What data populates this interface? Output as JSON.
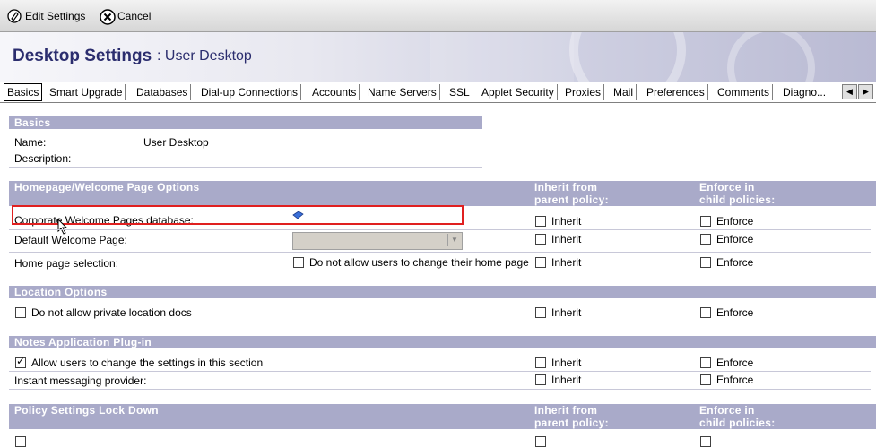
{
  "toolbar": {
    "edit_label": "Edit Settings",
    "cancel_label": "Cancel"
  },
  "header": {
    "title": "Desktop Settings",
    "subtitle": ": User Desktop"
  },
  "tabs": [
    {
      "label": "Basics"
    },
    {
      "label": "Smart Upgrade"
    },
    {
      "label": "Databases"
    },
    {
      "label": "Dial-up Connections"
    },
    {
      "label": "Accounts"
    },
    {
      "label": "Name Servers"
    },
    {
      "label": "SSL"
    },
    {
      "label": "Applet Security"
    },
    {
      "label": "Proxies"
    },
    {
      "label": "Mail"
    },
    {
      "label": "Preferences"
    },
    {
      "label": "Comments"
    },
    {
      "label": "Diagno..."
    }
  ],
  "basics": {
    "heading": "Basics",
    "name_label": "Name:",
    "name_value": "User Desktop",
    "description_label": "Description:"
  },
  "homepage": {
    "heading": "Homepage/Welcome Page Options",
    "inherit_head": "Inherit from",
    "inherit_head2": "parent policy:",
    "enforce_head": "Enforce in",
    "enforce_head2": "child policies:",
    "corp_label": "Corporate Welcome Pages database:",
    "default_label": "Default Welcome Page:",
    "homesel_label": "Home page selection:",
    "homesel_option": "Do not allow users to change their home page"
  },
  "common": {
    "inherit": "Inherit",
    "enforce": "Enforce"
  },
  "location": {
    "heading": "Location Options",
    "option": "Do not allow private location docs"
  },
  "plugin": {
    "heading": "Notes Application Plug-in",
    "allow_label": "Allow users to change the settings in this section",
    "im_label": "Instant messaging provider:"
  },
  "lockdown": {
    "heading": "Policy Settings Lock Down",
    "inherit_head": "Inherit from",
    "inherit_head2": "parent policy:",
    "enforce_head": "Enforce in",
    "enforce_head2": "child policies:"
  },
  "colors": {
    "section": "#a9aac9",
    "title": "#2b2d6e",
    "highlight": "#e02020"
  }
}
